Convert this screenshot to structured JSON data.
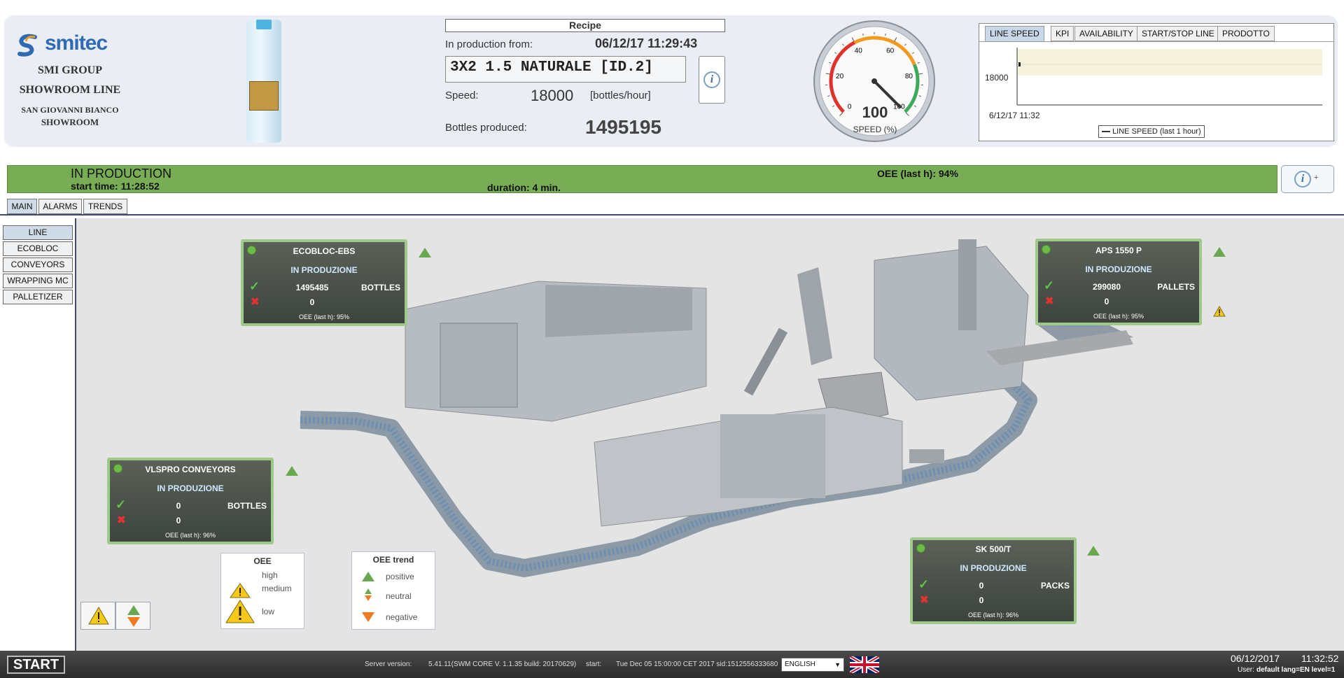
{
  "header": {
    "logo_text": "smitec",
    "company": "SMI GROUP",
    "line": "SHOWROOM LINE",
    "location": "SAN GIOVANNI BIANCO",
    "location2": "SHOWROOM",
    "recipe_title": "Recipe",
    "in_production_from_label": "In production from:",
    "in_production_from_value": "06/12/17 11:29:43",
    "recipe_name": "3X2 1.5 NATURALE [ID.2]",
    "speed_label": "Speed:",
    "speed_value": "18000",
    "speed_unit": "[bottles/hour]",
    "bottles_produced_label": "Bottles produced:",
    "bottles_produced_value": "1495195",
    "info_glyph": "i"
  },
  "gauge": {
    "value": 100,
    "value_text": "100",
    "label": "SPEED (%)",
    "ticks": [
      "0",
      "20",
      "40",
      "60",
      "80",
      "100"
    ],
    "colors": {
      "low": "#e0312b",
      "mid": "#f29a1f",
      "high": "#3fa95a"
    }
  },
  "chart_panel": {
    "tabs": [
      "LINE SPEED",
      "KPI",
      "AVAILABILITY",
      "START/STOP LINE",
      "PRODOTTO"
    ],
    "active_tab": "LINE SPEED"
  },
  "chart_data": {
    "type": "line",
    "ytick": "18000",
    "xtick": "6/12/17 11:32",
    "series": [
      {
        "name": "LINE SPEED (last 1 hour)",
        "values": [
          18000
        ]
      }
    ]
  },
  "status": {
    "state": "IN PRODUCTION",
    "start_time": "start time: 11:28:52",
    "duration": "duration: 4 min.",
    "oee": "OEE (last h): 94%",
    "info_plus": "+",
    "color": "#78ad55"
  },
  "main_tabs": [
    "MAIN",
    "ALARMS",
    "TRENDS"
  ],
  "side_nav": [
    "LINE",
    "ECOBLOC",
    "CONVEYORS",
    "WRAPPING MC",
    "PALLETIZER"
  ],
  "machines": [
    {
      "id": "ecobloc",
      "title": "ECOBLOC-EBS",
      "state": "IN PRODUZIONE",
      "count": "1495485",
      "unit": "BOTTLES",
      "rejects": "0",
      "oee": "OEE (last h): 95%"
    },
    {
      "id": "aps",
      "title": "APS 1550 P",
      "state": "IN PRODUZIONE",
      "count": "299080",
      "unit": "PALLETS",
      "rejects": "0",
      "oee": "OEE (last h): 95%"
    },
    {
      "id": "vlspro",
      "title": "VLSPRO CONVEYORS",
      "state": "IN PRODUZIONE",
      "count": "0",
      "unit": "BOTTLES",
      "rejects": "0",
      "oee": "OEE (last h): 96%"
    },
    {
      "id": "sk500",
      "title": "SK 500/T",
      "state": "IN PRODUZIONE",
      "count": "0",
      "unit": "PACKS",
      "rejects": "0",
      "oee": "OEE (last h): 96%"
    }
  ],
  "legend_oee": {
    "title": "OEE",
    "high": "high",
    "medium": "medium",
    "low": "low"
  },
  "legend_trend": {
    "title": "OEE trend",
    "positive": "positive",
    "neutral": "neutral",
    "negative": "negative"
  },
  "bottom": {
    "start": "START",
    "server_label": "Server version:",
    "server_value": "5.41.11(SWM CORE V. 1.1.35 build: 20170629)",
    "start_label": "start:",
    "start_value": "Tue Dec 05 15:00:00 CET 2017 sid:1512556333680",
    "language": "ENGLISH",
    "date": "06/12/2017",
    "time": "11:32:52",
    "user_label": "User:",
    "user_value": "default lang=EN level=1"
  }
}
